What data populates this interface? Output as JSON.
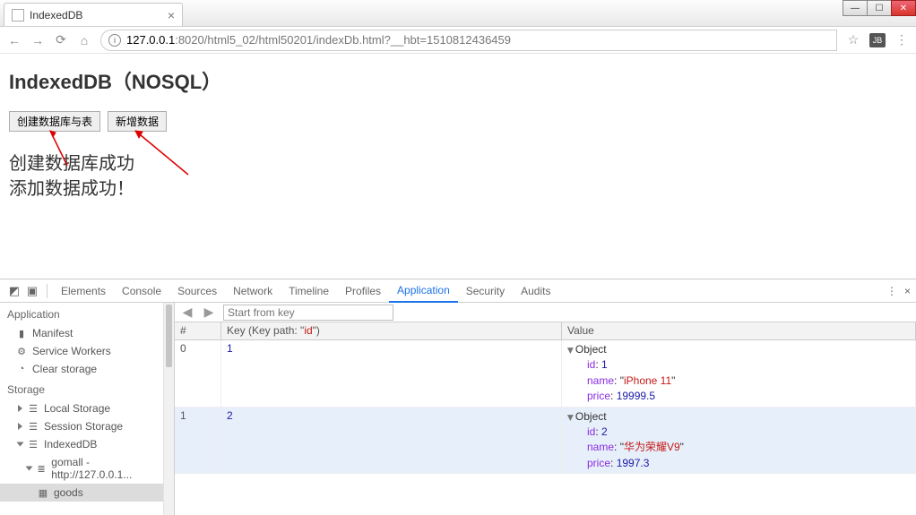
{
  "window": {
    "tab_title": "IndexedDB"
  },
  "toolbar": {
    "url_host": "127.0.0.1",
    "url_path": ":8020/html5_02/html50201/indexDb.html?__hbt=1510812436459"
  },
  "page": {
    "heading": "IndexedDB（NOSQL）",
    "btn_create": "创建数据库与表",
    "btn_add": "新增数据",
    "msg1": "创建数据库成功",
    "msg2": "添加数据成功！"
  },
  "devtools": {
    "tabs": [
      "Elements",
      "Console",
      "Sources",
      "Network",
      "Timeline",
      "Profiles",
      "Application",
      "Security",
      "Audits"
    ],
    "active_tab": "Application",
    "sidebar": {
      "section_app": "Application",
      "manifest": "Manifest",
      "service_workers": "Service Workers",
      "clear_storage": "Clear storage",
      "section_storage": "Storage",
      "local_storage": "Local Storage",
      "session_storage": "Session Storage",
      "indexeddb": "IndexedDB",
      "db": "gomall - http://127.0.0.1...",
      "store": "goods"
    },
    "controls": {
      "start_placeholder": "Start from key"
    },
    "grid": {
      "col_idx": "#",
      "col_key_prefix": "Key (Key path: ",
      "col_key_path": "id",
      "col_key_suffix": ")",
      "col_val": "Value"
    },
    "rows": [
      {
        "idx": "0",
        "key": "1",
        "obj": {
          "id": "1",
          "name": "iPhone 11",
          "price": "19999.5"
        }
      },
      {
        "idx": "1",
        "key": "2",
        "obj": {
          "id": "2",
          "name": "华为荣耀V9",
          "price": "1997.3"
        }
      }
    ],
    "object_label": "Object",
    "prop_id": "id",
    "prop_name": "name",
    "prop_price": "price"
  }
}
